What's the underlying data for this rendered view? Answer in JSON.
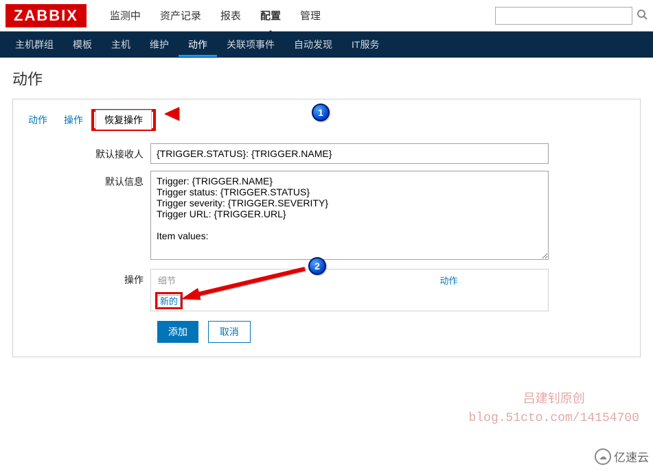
{
  "logo": "ZABBIX",
  "topnav": {
    "items": [
      "监测中",
      "资产记录",
      "报表",
      "配置",
      "管理"
    ],
    "active_index": 3
  },
  "search": {
    "placeholder": ""
  },
  "subnav": {
    "items": [
      "主机群组",
      "模板",
      "主机",
      "维护",
      "动作",
      "关联项事件",
      "自动发现",
      "IT服务"
    ],
    "active_index": 4
  },
  "page_title": "动作",
  "tabs": {
    "items": [
      "动作",
      "操作",
      "恢复操作"
    ],
    "selected_index": 2
  },
  "form": {
    "default_subject_label": "默认接收人",
    "default_subject_value": "{TRIGGER.STATUS}: {TRIGGER.NAME}",
    "default_message_label": "默认信息",
    "default_message_value": "Trigger: {TRIGGER.NAME}\nTrigger status: {TRIGGER.STATUS}\nTrigger severity: {TRIGGER.SEVERITY}\nTrigger URL: {TRIGGER.URL}\n\nItem values:",
    "operations_label": "操作",
    "ops_col1": "细节",
    "ops_col2": "动作",
    "ops_new": "新的",
    "add_button": "添加",
    "cancel_button": "取消"
  },
  "annotations": {
    "marker1": "1",
    "marker2": "2"
  },
  "watermark": {
    "line1": "吕建钊原创",
    "line2": "blog.51cto.com/14154700",
    "brand": "亿速云"
  }
}
